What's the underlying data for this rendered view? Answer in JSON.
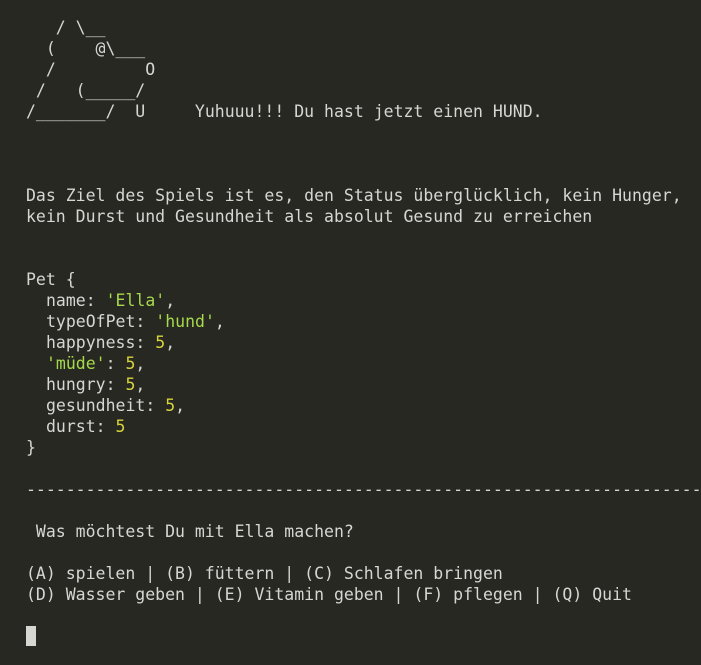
{
  "ascii_art": [
    "   / \\__",
    "  (    @\\___",
    "  /         O",
    " /   (_____/",
    "/_______/  U"
  ],
  "greeting": "Yuhuuu!!! Du hast jetzt einen HUND.",
  "goal_lines": [
    "Das Ziel des Spiels ist es, den Status überglücklich, kein Hunger,",
    "kein Durst und Gesundheit als absolut Gesund zu erreichen"
  ],
  "pet": {
    "open": "Pet {",
    "close": "}",
    "name_key": "name: ",
    "name_val": "'Ella'",
    "type_key": "typeOfPet: ",
    "type_val": "'hund'",
    "happy_key": "happyness: ",
    "happy_val": "5",
    "tired_key": "'müde'",
    "tired_sep": ": ",
    "tired_val": "5",
    "hungry_key": "hungry: ",
    "hungry_val": "5",
    "health_key": "gesundheit: ",
    "health_val": "5",
    "thirst_key": "durst: ",
    "thirst_val": "5",
    "comma": ","
  },
  "separator": "-----------------------------------------------------------------------",
  "question": " Was möchtest Du mit Ella machen?",
  "menu_lines": [
    "(A) spielen | (B) füttern | (C) Schlafen bringen",
    "(D) Wasser geben | (E) Vitamin geben | (F) pflegen | (Q) Quit"
  ],
  "colors": {
    "background": "#272822",
    "text": "#d6d6d2",
    "string": "#a6d94b",
    "number": "#d7d43c"
  }
}
